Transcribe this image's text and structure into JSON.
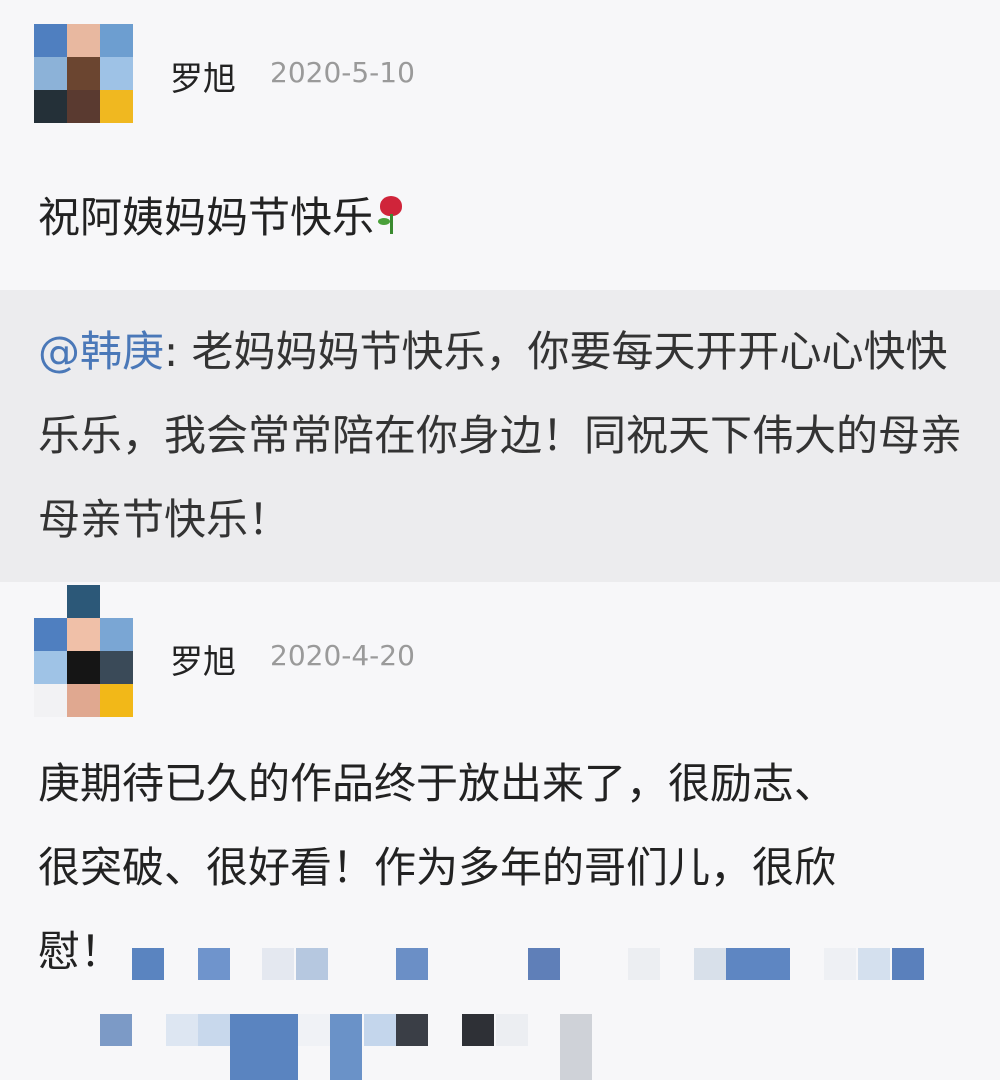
{
  "posts": [
    {
      "username": "罗旭",
      "timestamp": "2020-5-10",
      "text": "祝阿姨妈妈节快乐",
      "emoji": "rose-icon",
      "quote": {
        "mention": "@韩庚",
        "text": ": 老妈妈妈节快乐，你要每天开开心心快快乐乐，我会常常陪在你身边！同祝天下伟大的母亲母亲节快乐！"
      }
    },
    {
      "username": "罗旭",
      "timestamp": "2020-4-20",
      "text_lines": [
        "庚期待已久的作品终于放出来了，很励志、",
        "很突破、很好看！作为多年的哥们儿，很欣",
        "慰！"
      ]
    }
  ],
  "colors": {
    "mention": "#4a78b8",
    "quote_background": "#ececee",
    "timestamp": "#9a9a9a",
    "background": "#f7f7f9"
  }
}
